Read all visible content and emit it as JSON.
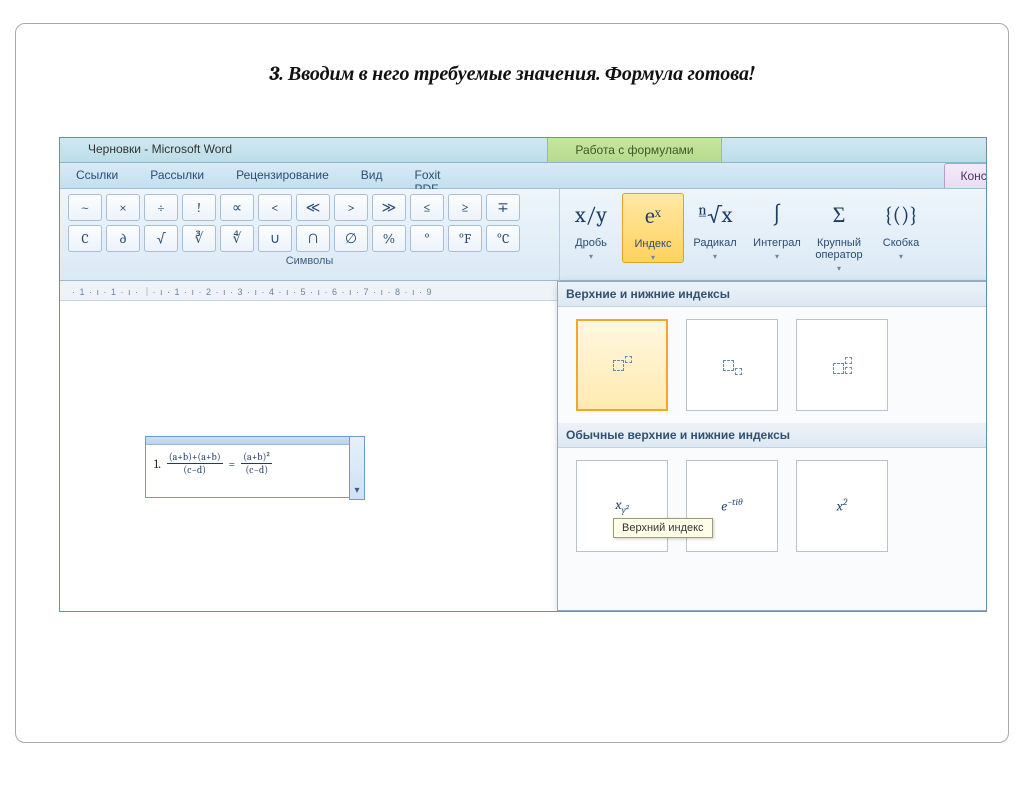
{
  "slide_title": "3. Вводим в него требуемые значения. Формула готова!",
  "window_title": "Черновки - Microsoft Word",
  "tool_tab_title": "Работа с формулами",
  "tabs": [
    "Ссылки",
    "Рассылки",
    "Рецензирование",
    "Вид",
    "Foxit PDF"
  ],
  "active_tab": "Конструктор",
  "symbols_group_label": "Символы",
  "symbol_rows": [
    [
      "~",
      "×",
      "÷",
      "!",
      "∝",
      "<",
      "≪",
      ">",
      "≫",
      "≤",
      "≥",
      "∓"
    ],
    [
      "C",
      "∂",
      "√",
      "∛",
      "∜",
      "∪",
      "∩",
      "∅",
      "%",
      "°",
      "°F",
      "°C"
    ]
  ],
  "structures": [
    {
      "label": "Дробь",
      "icon": "x/y"
    },
    {
      "label": "Индекс",
      "icon": "eˣ",
      "selected": true
    },
    {
      "label": "Радикал",
      "icon": "ⁿ√x"
    },
    {
      "label": "Интеграл",
      "icon": "∫"
    },
    {
      "label": "Крупный оператор",
      "icon": "Σ"
    },
    {
      "label": "Скобка",
      "icon": "{()}"
    }
  ],
  "ruler_text": "· 1 · ı · 1 · ı · ｜· ı · 1 · ı · 2 · ı · 3 · ı · 4 · ı · 5 · ı · 6 · ı · 7 · ı · 8 · ı · 9",
  "equation": {
    "list_number": "1.",
    "lhs_top": "(a+b)+(a+b)",
    "lhs_bot": "(c−d)",
    "eq": " = ",
    "rhs_top": "(a+b)²",
    "rhs_bot": "(c−d)"
  },
  "gallery": {
    "header1": "Верхние и нижние индексы",
    "header2": "Обычные верхние и нижние индексы",
    "tooltip": "Верхний индекс",
    "row2_items": [
      "x_{y^2}",
      "e^{−tiθ}",
      "x^2"
    ]
  }
}
